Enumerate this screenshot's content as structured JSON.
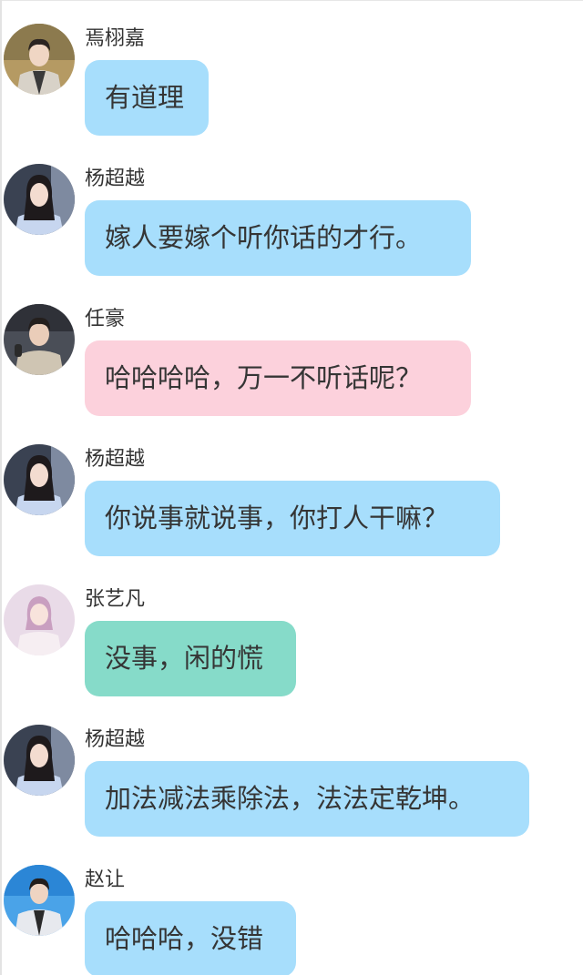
{
  "colors": {
    "blue_bubble": "#a7defc",
    "pink_bubble": "#fcd1dc",
    "green_bubble": "#86dbc9",
    "text": "#353535"
  },
  "messages": [
    {
      "sender": "焉栩嘉",
      "text": "有道理",
      "bubble_color": "blue",
      "avatar_icon": "male-avatar-icon"
    },
    {
      "sender": "杨超越",
      "text": "嫁人要嫁个听你话的才行。",
      "bubble_color": "blue",
      "avatar_icon": "female-avatar-icon"
    },
    {
      "sender": "任豪",
      "text": "哈哈哈哈，万一不听话呢？",
      "bubble_color": "pink",
      "avatar_icon": "male-avatar-icon"
    },
    {
      "sender": "杨超越",
      "text": "你说事就说事，你打人干嘛？",
      "bubble_color": "blue",
      "avatar_icon": "female-avatar-icon"
    },
    {
      "sender": "张艺凡",
      "text": "没事，闲的慌",
      "bubble_color": "green",
      "avatar_icon": "female-avatar-icon"
    },
    {
      "sender": "杨超越",
      "text": "加法减法乘除法，法法定乾坤。",
      "bubble_color": "blue",
      "avatar_icon": "female-avatar-icon"
    },
    {
      "sender": "赵让",
      "text": "哈哈哈，没错",
      "bubble_color": "blue",
      "avatar_icon": "male-avatar-icon"
    }
  ]
}
